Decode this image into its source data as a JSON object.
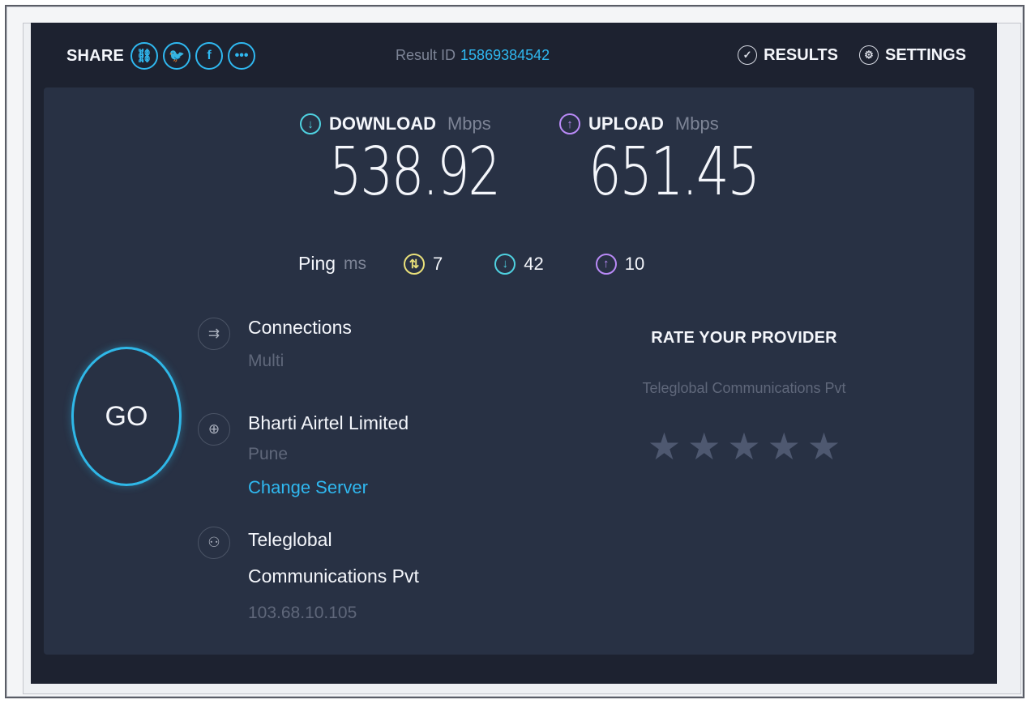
{
  "share": {
    "label": "SHARE",
    "icons": [
      "link-icon",
      "twitter-icon",
      "facebook-icon",
      "more-icon"
    ]
  },
  "result": {
    "label": "Result ID",
    "id": "15869384542"
  },
  "nav": {
    "results": "RESULTS",
    "settings": "SETTINGS"
  },
  "download": {
    "label": "DOWNLOAD",
    "unit": "Mbps",
    "value": "538.92"
  },
  "upload": {
    "label": "UPLOAD",
    "unit": "Mbps",
    "value": "651.45"
  },
  "ping": {
    "label": "Ping",
    "unit": "ms",
    "idle": "7",
    "download": "42",
    "upload": "10"
  },
  "go": {
    "label": "GO"
  },
  "connections": {
    "title": "Connections",
    "value": "Multi"
  },
  "server": {
    "title": "Bharti Airtel Limited",
    "location": "Pune",
    "change": "Change Server"
  },
  "provider": {
    "title": "Teleglobal Communications Pvt",
    "ip": "103.68.10.105"
  },
  "rate": {
    "title": "RATE YOUR PROVIDER",
    "provider": "Teleglobal Communications Pvt",
    "stars": 5
  },
  "colors": {
    "accent": "#2fb8f0",
    "download": "#4fd1e0",
    "upload": "#b98af7",
    "ping": "#e9e07a",
    "background": "#1d2230",
    "panel": "#283144"
  }
}
